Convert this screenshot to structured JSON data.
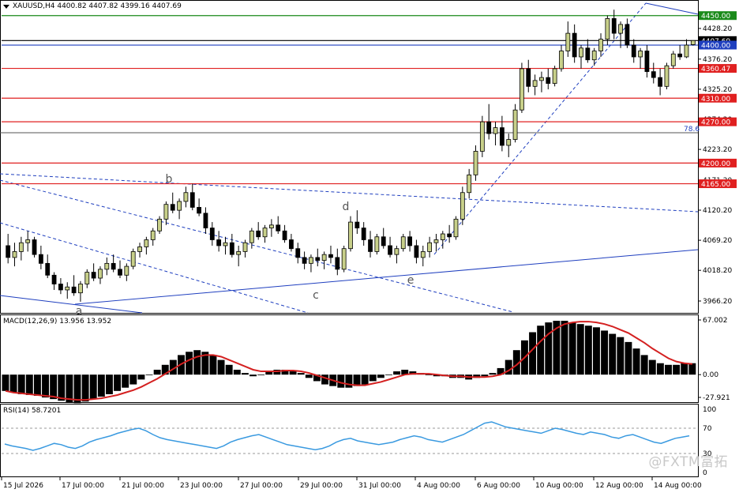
{
  "header": {
    "symbol_line": "XAUUSD,H4  4400.82 4407.82 4399.16 4407.69"
  },
  "main": {
    "price_labels": [
      "4428.20",
      "4376.20",
      "4325.20",
      "4274.20",
      "4223.20",
      "4171.20",
      "4120.20",
      "4069.20",
      "4018.20",
      "3966.20"
    ],
    "hlines": [
      {
        "label": "4450.00",
        "price": 4450,
        "color": "#1a8a1a",
        "box": "#1a8a1a"
      },
      {
        "label": "4407.69",
        "price": 4407.69,
        "color": "#000000",
        "box": "#000000"
      },
      {
        "label": "4400.00",
        "price": 4400,
        "color": "#1f3fbf",
        "box": "#1f3fbf"
      },
      {
        "label": "4360.47",
        "price": 4360.47,
        "color": "#e02020",
        "box": "#e02020"
      },
      {
        "label": "4310.00",
        "price": 4310,
        "color": "#e02020",
        "box": "#e02020"
      },
      {
        "label": "4270.00",
        "price": 4270,
        "color": "#e02020",
        "box": "#e02020"
      },
      {
        "label": "4200.00",
        "price": 4200,
        "color": "#e02020",
        "box": "#e02020"
      },
      {
        "label": "4165.00",
        "price": 4165,
        "color": "#e02020",
        "box": "#e02020"
      }
    ],
    "fib_label": "78.6",
    "waves": [
      "a",
      "b",
      "c",
      "d",
      "e"
    ],
    "candles": [
      [
        4060,
        4080,
        4030,
        4040
      ],
      [
        4040,
        4065,
        4025,
        4050
      ],
      [
        4050,
        4075,
        4035,
        4065
      ],
      [
        4065,
        4085,
        4050,
        4070
      ],
      [
        4070,
        4075,
        4040,
        4045
      ],
      [
        4045,
        4060,
        4020,
        4030
      ],
      [
        4030,
        4045,
        4005,
        4010
      ],
      [
        4010,
        4015,
        3985,
        3995
      ],
      [
        3995,
        4005,
        3978,
        3985
      ],
      [
        3985,
        3998,
        3970,
        3990
      ],
      [
        3990,
        4010,
        3975,
        3980
      ],
      [
        3980,
        4000,
        3965,
        3995
      ],
      [
        3995,
        4020,
        3988,
        4015
      ],
      [
        4015,
        4030,
        4000,
        4005
      ],
      [
        4005,
        4025,
        3995,
        4020
      ],
      [
        4020,
        4040,
        4010,
        4030
      ],
      [
        4030,
        4045,
        4015,
        4020
      ],
      [
        4020,
        4035,
        4005,
        4010
      ],
      [
        4010,
        4030,
        4000,
        4025
      ],
      [
        4025,
        4055,
        4020,
        4050
      ],
      [
        4050,
        4065,
        4040,
        4058
      ],
      [
        4058,
        4075,
        4045,
        4070
      ],
      [
        4070,
        4090,
        4060,
        4085
      ],
      [
        4085,
        4110,
        4080,
        4105
      ],
      [
        4105,
        4135,
        4095,
        4130
      ],
      [
        4130,
        4150,
        4115,
        4120
      ],
      [
        4120,
        4140,
        4105,
        4135
      ],
      [
        4135,
        4160,
        4125,
        4150
      ],
      [
        4150,
        4165,
        4120,
        4125
      ],
      [
        4125,
        4140,
        4110,
        4115
      ],
      [
        4115,
        4125,
        4080,
        4090
      ],
      [
        4090,
        4100,
        4060,
        4070
      ],
      [
        4070,
        4085,
        4050,
        4060
      ],
      [
        4060,
        4075,
        4045,
        4065
      ],
      [
        4065,
        4080,
        4040,
        4045
      ],
      [
        4045,
        4060,
        4025,
        4050
      ],
      [
        4050,
        4070,
        4040,
        4065
      ],
      [
        4065,
        4090,
        4055,
        4085
      ],
      [
        4085,
        4100,
        4070,
        4075
      ],
      [
        4075,
        4095,
        4065,
        4090
      ],
      [
        4090,
        4105,
        4075,
        4095
      ],
      [
        4095,
        4110,
        4080,
        4085
      ],
      [
        4085,
        4095,
        4065,
        4070
      ],
      [
        4070,
        4080,
        4050,
        4055
      ],
      [
        4055,
        4065,
        4030,
        4040
      ],
      [
        4040,
        4050,
        4020,
        4030
      ],
      [
        4030,
        4045,
        4015,
        4040
      ],
      [
        4040,
        4055,
        4025,
        4035
      ],
      [
        4035,
        4050,
        4020,
        4045
      ],
      [
        4045,
        4060,
        4030,
        4040
      ],
      [
        4040,
        4055,
        4010,
        4020
      ],
      [
        4020,
        4060,
        4015,
        4055
      ],
      [
        4055,
        4110,
        4050,
        4100
      ],
      [
        4100,
        4120,
        4080,
        4090
      ],
      [
        4090,
        4100,
        4060,
        4070
      ],
      [
        4070,
        4085,
        4040,
        4050
      ],
      [
        4050,
        4080,
        4045,
        4075
      ],
      [
        4075,
        4090,
        4055,
        4060
      ],
      [
        4060,
        4075,
        4040,
        4045
      ],
      [
        4045,
        4060,
        4030,
        4055
      ],
      [
        4055,
        4080,
        4050,
        4075
      ],
      [
        4075,
        4085,
        4050,
        4060
      ],
      [
        4060,
        4070,
        4030,
        4040
      ],
      [
        4040,
        4060,
        4025,
        4050
      ],
      [
        4050,
        4075,
        4040,
        4065
      ],
      [
        4065,
        4080,
        4050,
        4070
      ],
      [
        4070,
        4085,
        4055,
        4080
      ],
      [
        4080,
        4095,
        4065,
        4075
      ],
      [
        4075,
        4110,
        4070,
        4105
      ],
      [
        4105,
        4160,
        4095,
        4150
      ],
      [
        4150,
        4190,
        4140,
        4180
      ],
      [
        4180,
        4230,
        4170,
        4220
      ],
      [
        4220,
        4280,
        4210,
        4270
      ],
      [
        4270,
        4300,
        4240,
        4250
      ],
      [
        4250,
        4270,
        4230,
        4260
      ],
      [
        4260,
        4280,
        4220,
        4230
      ],
      [
        4230,
        4250,
        4210,
        4240
      ],
      [
        4240,
        4300,
        4235,
        4290
      ],
      [
        4290,
        4370,
        4285,
        4360
      ],
      [
        4360,
        4375,
        4320,
        4330
      ],
      [
        4330,
        4350,
        4315,
        4340
      ],
      [
        4340,
        4355,
        4320,
        4345
      ],
      [
        4345,
        4360,
        4325,
        4335
      ],
      [
        4335,
        4365,
        4330,
        4360
      ],
      [
        4360,
        4400,
        4355,
        4390
      ],
      [
        4390,
        4440,
        4380,
        4420
      ],
      [
        4420,
        4435,
        4370,
        4380
      ],
      [
        4380,
        4400,
        4360,
        4395
      ],
      [
        4395,
        4410,
        4370,
        4375
      ],
      [
        4375,
        4395,
        4365,
        4390
      ],
      [
        4390,
        4420,
        4380,
        4410
      ],
      [
        4410,
        4450,
        4400,
        4445
      ],
      [
        4445,
        4460,
        4410,
        4420
      ],
      [
        4420,
        4440,
        4395,
        4435
      ],
      [
        4435,
        4445,
        4395,
        4400
      ],
      [
        4400,
        4410,
        4370,
        4380
      ],
      [
        4380,
        4395,
        4360,
        4390
      ],
      [
        4390,
        4400,
        4345,
        4355
      ],
      [
        4355,
        4370,
        4335,
        4345
      ],
      [
        4345,
        4360,
        4315,
        4330
      ],
      [
        4330,
        4370,
        4325,
        4365
      ],
      [
        4365,
        4390,
        4360,
        4385
      ],
      [
        4385,
        4400,
        4375,
        4380
      ],
      [
        4380,
        4410,
        4378,
        4400
      ],
      [
        4400.82,
        4407.82,
        4399.16,
        4407.69
      ]
    ]
  },
  "macd": {
    "label": "MACD(12,26,9) 13.956 13.952",
    "scale": [
      "67.002",
      "0.00",
      "-27.921"
    ],
    "bars": [
      -20,
      -22,
      -24,
      -25,
      -26,
      -28,
      -30,
      -32,
      -34,
      -35,
      -33,
      -30,
      -27,
      -24,
      -20,
      -16,
      -12,
      -6,
      0,
      6,
      12,
      18,
      24,
      28,
      30,
      28,
      24,
      18,
      12,
      6,
      2,
      -2,
      0,
      4,
      6,
      6,
      4,
      2,
      -4,
      -8,
      -12,
      -14,
      -16,
      -16,
      -14,
      -12,
      -8,
      -4,
      0,
      4,
      6,
      4,
      2,
      0,
      -2,
      -2,
      -4,
      -4,
      -6,
      -4,
      -2,
      2,
      8,
      18,
      30,
      42,
      52,
      60,
      64,
      66,
      66,
      64,
      62,
      60,
      58,
      54,
      50,
      46,
      40,
      32,
      24,
      18,
      14,
      12,
      12,
      14,
      14
    ],
    "signal": [
      -20,
      -22,
      -23,
      -24,
      -25,
      -26,
      -27,
      -29,
      -30,
      -31,
      -31,
      -30,
      -29,
      -27,
      -25,
      -22,
      -19,
      -15,
      -10,
      -5,
      1,
      7,
      13,
      18,
      22,
      24,
      24,
      22,
      18,
      14,
      10,
      6,
      4,
      4,
      4,
      5,
      5,
      4,
      2,
      -1,
      -4,
      -7,
      -10,
      -12,
      -13,
      -13,
      -11,
      -9,
      -6,
      -3,
      0,
      1,
      1,
      1,
      0,
      -1,
      -2,
      -2,
      -3,
      -3,
      -3,
      -2,
      0,
      5,
      12,
      21,
      31,
      41,
      50,
      57,
      62,
      64,
      65,
      65,
      64,
      62,
      59,
      55,
      51,
      45,
      39,
      32,
      26,
      20,
      16,
      14,
      13
    ]
  },
  "rsi": {
    "label": "RSI(14) 58.7201",
    "scale": [
      "100",
      "70",
      "30",
      "0"
    ],
    "values": [
      45,
      42,
      40,
      38,
      35,
      38,
      42,
      46,
      44,
      40,
      38,
      42,
      48,
      52,
      55,
      58,
      62,
      65,
      68,
      70,
      66,
      60,
      55,
      52,
      50,
      48,
      46,
      44,
      42,
      40,
      38,
      42,
      48,
      52,
      55,
      58,
      60,
      56,
      52,
      48,
      44,
      42,
      40,
      38,
      36,
      38,
      42,
      48,
      52,
      54,
      50,
      48,
      46,
      44,
      46,
      48,
      52,
      55,
      58,
      56,
      52,
      50,
      48,
      52,
      56,
      60,
      66,
      72,
      78,
      80,
      76,
      72,
      70,
      68,
      66,
      64,
      62,
      66,
      70,
      68,
      65,
      62,
      60,
      64,
      62,
      60,
      56,
      54,
      58,
      60,
      56,
      52,
      48,
      46,
      50,
      54,
      56,
      58
    ]
  },
  "xaxis": {
    "labels": [
      "15 Jul 2026",
      "17 Jul 00:00",
      "21 Jul 00:00",
      "23 Jul 00:00",
      "27 Jul 00:00",
      "29 Jul 00:00",
      "31 Jul 00:00",
      "4 Aug 00:00",
      "6 Aug 00:00",
      "10 Aug 00:00",
      "12 Aug 00:00",
      "14 Aug 00:00"
    ]
  },
  "watermark": "@FXTM富拓",
  "colors": {
    "up_fill": "#c8d08a",
    "down_fill": "#000000",
    "macd_signal": "#d42020",
    "rsi_line": "#3a9ae0"
  }
}
